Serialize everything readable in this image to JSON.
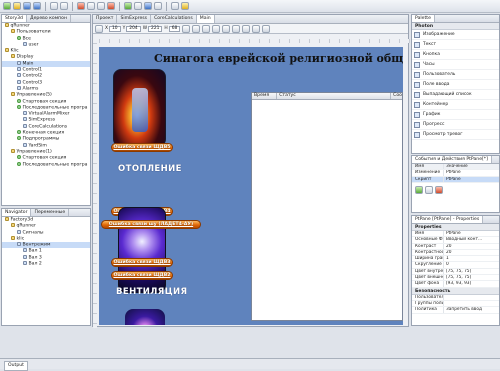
{
  "project_tabs": [
    "Story3d",
    "Дерево компон"
  ],
  "project_tree": [
    {
      "label": "qRunner",
      "depth": 0,
      "icon": "folder"
    },
    {
      "label": "Пользователи",
      "depth": 1,
      "icon": "folder"
    },
    {
      "label": "Все",
      "depth": 2,
      "icon": "group"
    },
    {
      "label": "user",
      "depth": 3,
      "icon": "node"
    },
    {
      "label": "Klic",
      "depth": 0,
      "icon": "folder"
    },
    {
      "label": "Display",
      "depth": 1,
      "icon": "folder"
    },
    {
      "label": "Main",
      "depth": 2,
      "icon": "node",
      "selected": true
    },
    {
      "label": "Control1",
      "depth": 2,
      "icon": "node"
    },
    {
      "label": "Control2",
      "depth": 2,
      "icon": "node"
    },
    {
      "label": "Control3",
      "depth": 2,
      "icon": "node"
    },
    {
      "label": "Alarms",
      "depth": 2,
      "icon": "node"
    },
    {
      "label": "Управление(5)",
      "depth": 1,
      "icon": "folder"
    },
    {
      "label": "Стартовая секция",
      "depth": 2,
      "icon": "group"
    },
    {
      "label": "Последовательные програ",
      "depth": 2,
      "icon": "group"
    },
    {
      "label": "VirtualAlarmMixer",
      "depth": 3,
      "icon": "node"
    },
    {
      "label": "SimExpress",
      "depth": 3,
      "icon": "node"
    },
    {
      "label": "CoreCalculations",
      "depth": 3,
      "icon": "node"
    },
    {
      "label": "Конечная секция",
      "depth": 2,
      "icon": "group"
    },
    {
      "label": "Подпрограммы",
      "depth": 2,
      "icon": "group"
    },
    {
      "label": "YardSim",
      "depth": 3,
      "icon": "node"
    },
    {
      "label": "Управление(1)",
      "depth": 1,
      "icon": "folder"
    },
    {
      "label": "Стартовая секция",
      "depth": 2,
      "icon": "group"
    },
    {
      "label": "Последовательные програ",
      "depth": 2,
      "icon": "group"
    }
  ],
  "navigator_tabs": [
    "Navigator",
    "Переменные"
  ],
  "navigator_tree": [
    {
      "label": "Factory3d",
      "depth": 0,
      "icon": "folder"
    },
    {
      "label": "qRunner",
      "depth": 1,
      "icon": "folder"
    },
    {
      "label": "Сигналы",
      "depth": 2,
      "icon": "node"
    },
    {
      "label": "klic",
      "depth": 1,
      "icon": "folder"
    },
    {
      "label": "Вентрежим",
      "depth": 2,
      "icon": "node",
      "selected": true
    },
    {
      "label": "Вал 1",
      "depth": 3,
      "icon": "node"
    },
    {
      "label": "Вал 3",
      "depth": 3,
      "icon": "node"
    },
    {
      "label": "Вал 2",
      "depth": 3,
      "icon": "node"
    }
  ],
  "editor_tabs": [
    "Проект",
    "SimExpress",
    "CoreCalculations",
    "Main"
  ],
  "coords": {
    "x_label": "X",
    "x_value": "10",
    "y_label": "Y",
    "y_value": "204",
    "w_label": "W",
    "w_value": "221",
    "h_label": "H",
    "h_value": "68"
  },
  "canvas": {
    "title": "Синагога еврейской религиозной общи",
    "caption_heating": "ОТОПЛЕНИЕ",
    "caption_vent": "ВЕНТИЛЯЦИЯ",
    "btn_err1": "Ошибка связи ЩДВ5",
    "btn_err2": "Ошибка связи ЩДВ4",
    "btn_err3": "Ошибка связи шу (ЛАДЕТ4-АУ)",
    "btn_err4": "Ошибка связи ЩДВ3",
    "btn_err5": "Ошибка связи ЩДВ2",
    "table_headers": [
      "Время",
      "Статус",
      "Соо"
    ]
  },
  "palette": {
    "title": "Palette",
    "group": "Photon",
    "items": [
      "Изображение",
      "Текст",
      "Кнопка",
      "Часы",
      "Пользователь",
      "Поле ввода",
      "Выпадающий список",
      "Контейнер",
      "График",
      "Прогресс",
      "Просмотр тревог"
    ]
  },
  "events": {
    "title": "События и Действия PtPane[*]",
    "col1": "Имя",
    "col2": "Значение",
    "row1": "Изменение",
    "row1_val": "PtPane",
    "row2": "Скрипт",
    "row2_val": "PtPane"
  },
  "properties": {
    "title": "PtPane [PtPane] - Properties",
    "group1": "Properties",
    "rows": [
      {
        "k": "Имя",
        "v": "PtPane"
      },
      {
        "k": "Основные Флаги",
        "v": "Вводный конт..."
      },
      {
        "k": "Контраст",
        "v": "20"
      },
      {
        "k": "Контрастность при",
        "v": "20"
      },
      {
        "k": "Ширина границы",
        "v": "1"
      },
      {
        "k": "Скругление",
        "v": "0"
      },
      {
        "k": "Цвет внутренней пр",
        "v": "[75, 75, 75]"
      },
      {
        "k": "Цвет внешней грани",
        "v": "[75, 75, 75]"
      },
      {
        "k": "Цвет фона",
        "v": "[93, 93, 93]"
      }
    ],
    "group2": "Безопасность",
    "rows2": [
      {
        "k": "Пользователи",
        "v": ""
      },
      {
        "k": "Группы пользоват",
        "v": ""
      },
      {
        "k": "Политика",
        "v": "Запретить ввод"
      }
    ]
  },
  "output_label": "Output"
}
